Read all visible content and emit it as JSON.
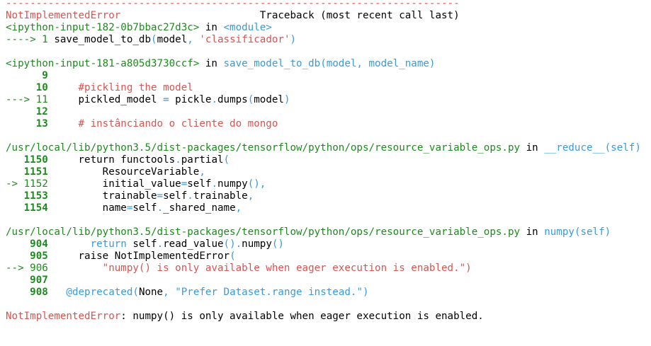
{
  "traceback": {
    "lines": [
      {
        "segments": [
          {
            "t": "---------------------------------------------------------------------------",
            "c": "red"
          }
        ]
      },
      {
        "segments": [
          {
            "t": "NotImplementedError",
            "c": "red"
          },
          {
            "t": "                       Traceback (most recent call last)",
            "c": "blk"
          }
        ]
      },
      {
        "segments": [
          {
            "t": "<ipython-input-182-0b7bbac27d3c>",
            "c": "grn"
          },
          {
            "t": " in ",
            "c": "blk"
          },
          {
            "t": "<module>",
            "c": "blu"
          }
        ]
      },
      {
        "segments": [
          {
            "t": "----> 1 ",
            "c": "grn"
          },
          {
            "t": "save_model_to_db",
            "c": "blk"
          },
          {
            "t": "(",
            "c": "blu"
          },
          {
            "t": "model",
            "c": "blk"
          },
          {
            "t": ", ",
            "c": "blu"
          },
          {
            "t": "'classificador'",
            "c": "red"
          },
          {
            "t": ")",
            "c": "blu"
          }
        ]
      },
      {
        "segments": [
          {
            "t": "",
            "c": "blk"
          }
        ]
      },
      {
        "segments": [
          {
            "t": "<ipython-input-181-a805d3730ccf>",
            "c": "grn"
          },
          {
            "t": " in ",
            "c": "blk"
          },
          {
            "t": "save_model_to_db",
            "c": "blu"
          },
          {
            "t": "(model, model_name)",
            "c": "blu"
          }
        ]
      },
      {
        "segments": [
          {
            "t": "      9",
            "c": "gb"
          }
        ]
      },
      {
        "segments": [
          {
            "t": "     10",
            "c": "gb"
          },
          {
            "t": "     ",
            "c": "blk"
          },
          {
            "t": "#pickling the model",
            "c": "red"
          }
        ]
      },
      {
        "segments": [
          {
            "t": "---> 11",
            "c": "grn"
          },
          {
            "t": "     pickled_model ",
            "c": "blk"
          },
          {
            "t": "=",
            "c": "blu"
          },
          {
            "t": " pickle",
            "c": "blk"
          },
          {
            "t": ".",
            "c": "blu"
          },
          {
            "t": "dumps",
            "c": "blk"
          },
          {
            "t": "(",
            "c": "blu"
          },
          {
            "t": "model",
            "c": "blk"
          },
          {
            "t": ")",
            "c": "blu"
          }
        ]
      },
      {
        "segments": [
          {
            "t": "     12",
            "c": "gb"
          }
        ]
      },
      {
        "segments": [
          {
            "t": "     13",
            "c": "gb"
          },
          {
            "t": "     ",
            "c": "blk"
          },
          {
            "t": "# instânciando o cliente do mongo",
            "c": "red"
          }
        ]
      },
      {
        "segments": [
          {
            "t": "",
            "c": "blk"
          }
        ]
      },
      {
        "segments": [
          {
            "t": "/usr/local/lib/python3.5/dist-packages/tensorflow/python/ops/resource_variable_ops.py",
            "c": "grn"
          },
          {
            "t": " in ",
            "c": "blk"
          },
          {
            "t": "__reduce__",
            "c": "blu"
          },
          {
            "t": "(self)",
            "c": "blu"
          }
        ]
      },
      {
        "segments": [
          {
            "t": "   1150",
            "c": "gb"
          },
          {
            "t": "     return",
            "c": "kw"
          },
          {
            "t": " functools",
            "c": "blk"
          },
          {
            "t": ".",
            "c": "blu"
          },
          {
            "t": "partial",
            "c": "blk"
          },
          {
            "t": "(",
            "c": "blu"
          }
        ]
      },
      {
        "segments": [
          {
            "t": "   1151",
            "c": "gb"
          },
          {
            "t": "         ResourceVariable",
            "c": "blk"
          },
          {
            "t": ",",
            "c": "blu"
          }
        ]
      },
      {
        "segments": [
          {
            "t": "-> 1152",
            "c": "grn"
          },
          {
            "t": "         initial_value",
            "c": "blk"
          },
          {
            "t": "=",
            "c": "blu"
          },
          {
            "t": "self",
            "c": "blk"
          },
          {
            "t": ".",
            "c": "blu"
          },
          {
            "t": "numpy",
            "c": "blk"
          },
          {
            "t": "(),",
            "c": "blu"
          }
        ]
      },
      {
        "segments": [
          {
            "t": "   1153",
            "c": "gb"
          },
          {
            "t": "         trainable",
            "c": "blk"
          },
          {
            "t": "=",
            "c": "blu"
          },
          {
            "t": "self",
            "c": "blk"
          },
          {
            "t": ".",
            "c": "blu"
          },
          {
            "t": "trainable",
            "c": "blk"
          },
          {
            "t": ",",
            "c": "blu"
          }
        ]
      },
      {
        "segments": [
          {
            "t": "   1154",
            "c": "gb"
          },
          {
            "t": "         name",
            "c": "blk"
          },
          {
            "t": "=",
            "c": "blu"
          },
          {
            "t": "self",
            "c": "blk"
          },
          {
            "t": ".",
            "c": "blu"
          },
          {
            "t": "_shared_name",
            "c": "blk"
          },
          {
            "t": ",",
            "c": "blu"
          }
        ]
      },
      {
        "segments": [
          {
            "t": "",
            "c": "blk"
          }
        ]
      },
      {
        "segments": [
          {
            "t": "/usr/local/lib/python3.5/dist-packages/tensorflow/python/ops/resource_variable_ops.py",
            "c": "grn"
          },
          {
            "t": " in ",
            "c": "blk"
          },
          {
            "t": "numpy",
            "c": "blu"
          },
          {
            "t": "(self)",
            "c": "blu"
          }
        ]
      },
      {
        "segments": [
          {
            "t": "    904",
            "c": "gb"
          },
          {
            "t": "       return",
            "c": "blu"
          },
          {
            "t": " self",
            "c": "blk"
          },
          {
            "t": ".",
            "c": "blu"
          },
          {
            "t": "read_value",
            "c": "blk"
          },
          {
            "t": "()",
            "c": "blu"
          },
          {
            "t": ".",
            "c": "blu"
          },
          {
            "t": "numpy",
            "c": "blk"
          },
          {
            "t": "()",
            "c": "blu"
          }
        ]
      },
      {
        "segments": [
          {
            "t": "    905",
            "c": "gb"
          },
          {
            "t": "     raise",
            "c": "kw"
          },
          {
            "t": " NotImplementedError",
            "c": "blk"
          },
          {
            "t": "(",
            "c": "blu"
          }
        ]
      },
      {
        "segments": [
          {
            "t": "--> 906",
            "c": "grn"
          },
          {
            "t": "         ",
            "c": "blk"
          },
          {
            "t": "\"numpy() is only available when eager execution is enabled.\")",
            "c": "red"
          }
        ]
      },
      {
        "segments": [
          {
            "t": "    907",
            "c": "gb"
          }
        ]
      },
      {
        "segments": [
          {
            "t": "    908",
            "c": "gb"
          },
          {
            "t": "   ",
            "c": "blk"
          },
          {
            "t": "@deprecated",
            "c": "blu"
          },
          {
            "t": "(",
            "c": "blu"
          },
          {
            "t": "None",
            "c": "blk"
          },
          {
            "t": ", ",
            "c": "blu"
          },
          {
            "t": "\"Prefer Dataset.range instead.\"",
            "c": "blu"
          },
          {
            "t": ")",
            "c": "blu"
          }
        ]
      },
      {
        "segments": [
          {
            "t": "",
            "c": "blk"
          }
        ]
      },
      {
        "segments": [
          {
            "t": "NotImplementedError",
            "c": "red"
          },
          {
            "t": ": numpy() is only available when eager execution is enabled.",
            "c": "blk"
          }
        ]
      }
    ]
  },
  "colors": {
    "red": "#d9534f",
    "green": "#1e8a1e",
    "blue": "#3b9ad9",
    "text": "#000000",
    "background": "#ffffff"
  }
}
